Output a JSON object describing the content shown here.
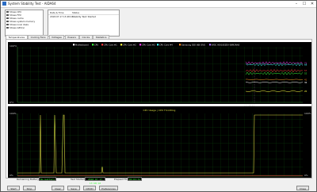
{
  "window": {
    "title": "System Stability Test - AIDA64",
    "minimize": "–",
    "maximize": "☐",
    "close": "✕"
  },
  "checks": [
    {
      "label": "Stress CPU",
      "checked": true
    },
    {
      "label": "Stress FPU",
      "checked": true
    },
    {
      "label": "Stress cache",
      "checked": true
    },
    {
      "label": "Stress system memory",
      "checked": true
    },
    {
      "label": "Stress local disks",
      "checked": false
    },
    {
      "label": "Stress GPU(s)",
      "checked": false
    }
  ],
  "status_list": {
    "header_time": "Date & Time",
    "header_status": "Status",
    "row_time": "2018.07.17 13:48:10",
    "row_status": "Stability Test: Started"
  },
  "tabs": [
    "Temperatures",
    "Cooling Fans",
    "Voltages",
    "Powers",
    "Clocks",
    "Statistics"
  ],
  "chart_data": [
    {
      "type": "line",
      "legend": [
        "Motherboard",
        "CPU",
        "CPU Core #1",
        "CPU Core #2",
        "CPU Core #3",
        "CPU Core #4",
        "Samsung SSD 860 EVO",
        "WDC WD10EZEX-08M2NA0"
      ],
      "legend_colors": [
        "#ffffff",
        "#3fff3f",
        "#ff4040",
        "#ffff40",
        "#ff40ff",
        "#40ffff",
        "#ff9020",
        "#b070ff"
      ],
      "y_top": "100°C",
      "y_bottom": "0°C",
      "x_label": "13:48:10",
      "right_labels": [
        "71",
        "68",
        "57",
        "52",
        "41",
        "36",
        "20"
      ]
    },
    {
      "type": "line",
      "title": "CPU Usage | CPU Throttling",
      "y_top": "100%",
      "y_bottom": "0%",
      "right_top": "100%",
      "right_bottom": "0%"
    }
  ],
  "bottom": {
    "remaining_battery_label": "Remaining Battery:",
    "remaining_battery_value": "No battery",
    "test_started_label": "Test Started:",
    "test_started_value": "2018.07.17 13:48:10",
    "elapsed_time_label": "Elapsed Time:",
    "elapsed_time_value": "00:03:51"
  },
  "buttons": {
    "start": "Start",
    "stop": "Stop",
    "clear": "Clear",
    "save": "Save",
    "cpuid": "CPUID",
    "preferences": "Preferences",
    "close": "Close"
  }
}
